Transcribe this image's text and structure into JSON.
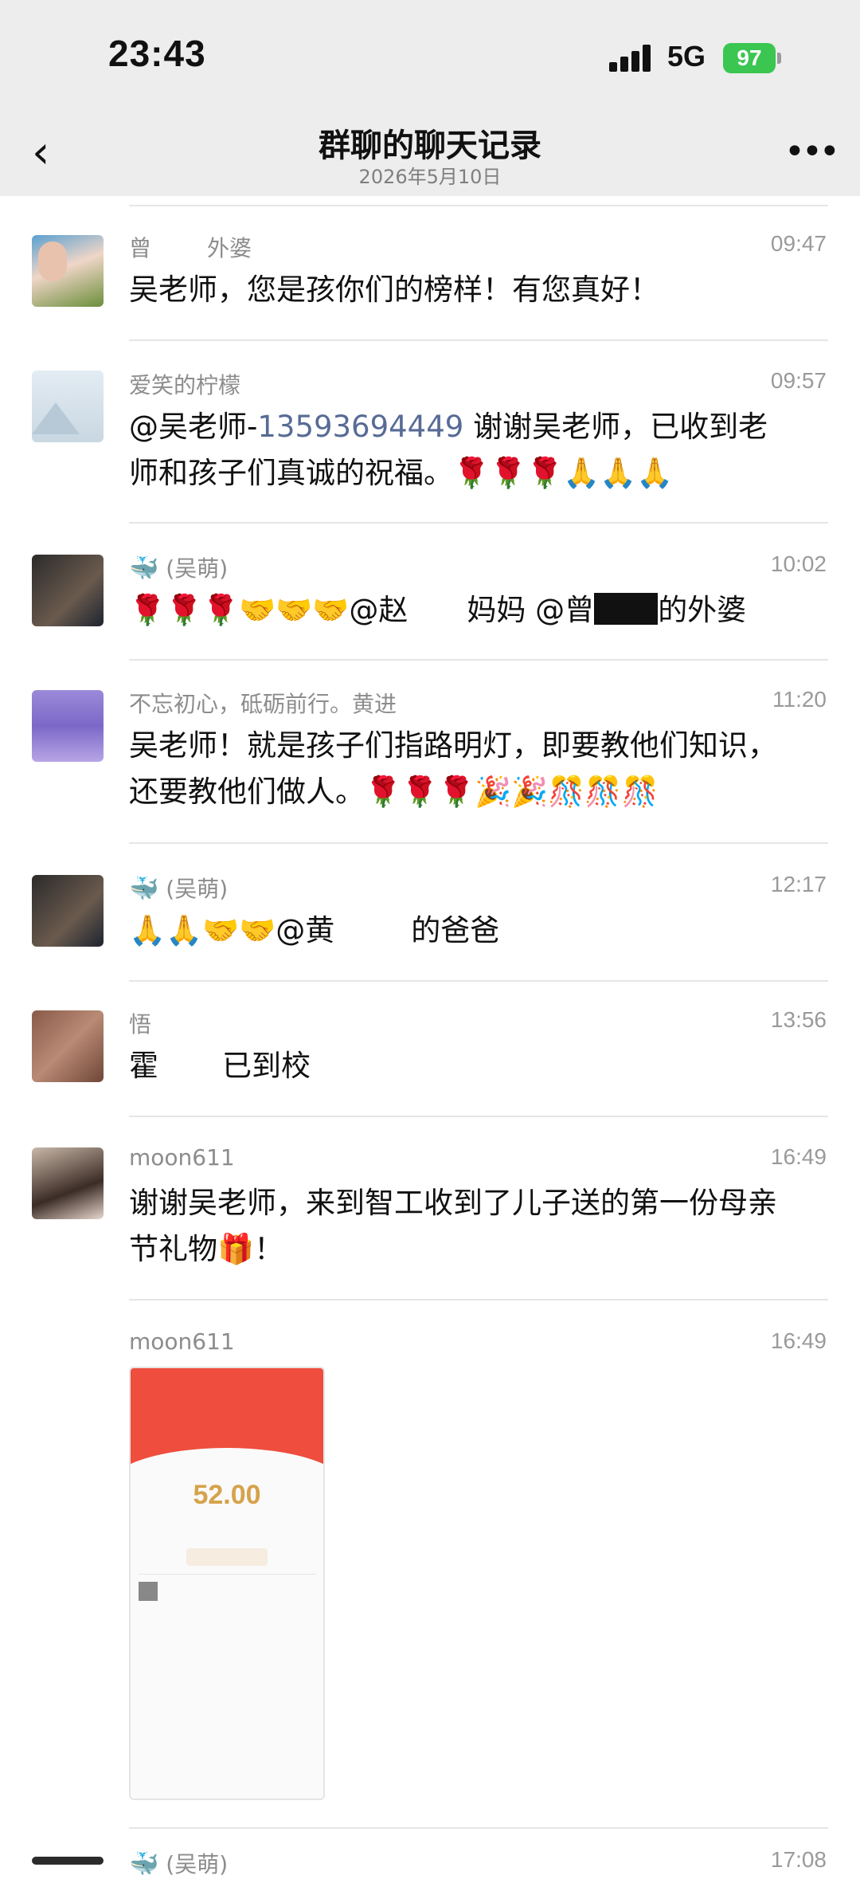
{
  "status": {
    "time": "23:43",
    "network": "5G",
    "battery": "97"
  },
  "nav": {
    "title": "群聊的聊天记录",
    "subtitle": "2026年5月10日"
  },
  "messages": [
    {
      "name_a": "曾",
      "name_b": "外婆",
      "time": "09:47",
      "text": "吴老师，您是孩你们的榜样！有您真好！"
    },
    {
      "name": "爱笑的柠檬",
      "time": "09:57",
      "mention": "@吴老师-",
      "phone": "13593694449",
      "line1_rest": " 谢谢吴老师，已收到老",
      "line2": "师和孩子们真诚的祝福。🌹🌹🌹🙏🙏🙏"
    },
    {
      "name": "(吴萌)",
      "time": "10:02",
      "text_a": "🌹🌹🌹🤝🤝🤝@赵",
      "text_b": "妈妈 @曾",
      "text_c": "的外婆"
    },
    {
      "name": "不忘初心，砥砺前行。黄进",
      "time": "11:20",
      "line1": "吴老师！就是孩子们指路明灯，即要教他们知识，",
      "line2": "还要教他们做人。🌹🌹🌹🎉🎉🎊🎊🎊"
    },
    {
      "name": "(吴萌)",
      "time": "12:17",
      "text_a": "🙏🙏🤝🤝@黄",
      "text_b": "的爸爸"
    },
    {
      "name": "悟",
      "time": "13:56",
      "text_a": "霍",
      "text_b": "已到校"
    },
    {
      "name": "moon611",
      "time": "16:49",
      "line1": "谢谢吴老师，来到智工收到了儿子送的第一份母亲",
      "line2": "节礼物🎁！"
    },
    {
      "name": "moon611",
      "time": "16:49",
      "image_amount": "52.00"
    },
    {
      "name": "(吴萌)",
      "time": "17:08"
    }
  ],
  "colors": {
    "header_bg": "#ededed",
    "link": "#576b95",
    "battery": "#3bc652",
    "red_packet": "#ef4d3d"
  }
}
